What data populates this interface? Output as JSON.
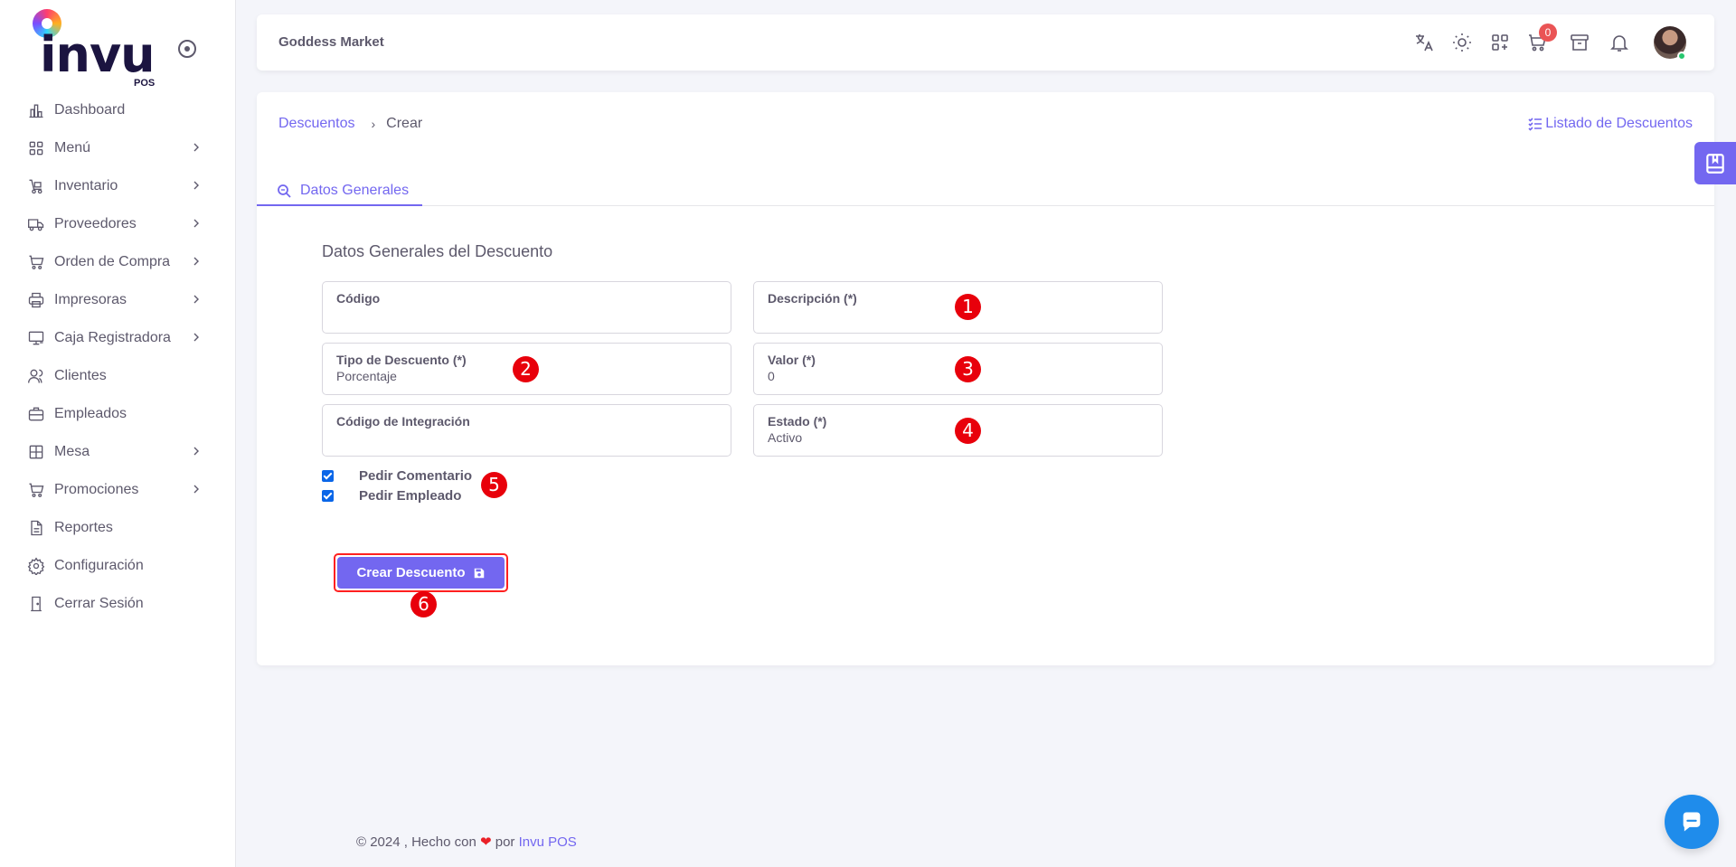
{
  "app": {
    "logo_text": "invu",
    "logo_sub": "POS"
  },
  "sidebar": {
    "items": [
      {
        "label": "Dashboard",
        "icon": "chart-bar-icon",
        "has_children": false
      },
      {
        "label": "Menú",
        "icon": "grid-icon",
        "has_children": true
      },
      {
        "label": "Inventario",
        "icon": "cart-dolly-icon",
        "has_children": true
      },
      {
        "label": "Proveedores",
        "icon": "truck-icon",
        "has_children": true
      },
      {
        "label": "Orden de Compra",
        "icon": "shopping-cart-icon",
        "has_children": true
      },
      {
        "label": "Impresoras",
        "icon": "printer-icon",
        "has_children": true
      },
      {
        "label": "Caja Registradora",
        "icon": "cash-register-icon",
        "has_children": true
      },
      {
        "label": "Clientes",
        "icon": "users-icon",
        "has_children": false
      },
      {
        "label": "Empleados",
        "icon": "briefcase-icon",
        "has_children": false
      },
      {
        "label": "Mesa",
        "icon": "table-icon",
        "has_children": true
      },
      {
        "label": "Promociones",
        "icon": "cart-promo-icon",
        "has_children": true
      },
      {
        "label": "Reportes",
        "icon": "document-icon",
        "has_children": false
      },
      {
        "label": "Configuración",
        "icon": "gear-icon",
        "has_children": false
      },
      {
        "label": "Cerrar Sesión",
        "icon": "door-icon",
        "has_children": false
      }
    ]
  },
  "topbar": {
    "store_name": "Goddess Market",
    "cart_count": "0",
    "icons": [
      "translate-icon",
      "sun-icon",
      "apps-add-icon",
      "cart-icon",
      "archive-icon",
      "bell-icon"
    ]
  },
  "breadcrumb": {
    "parent": "Descuentos",
    "current": "Crear"
  },
  "list_link": "Listado de Descuentos",
  "tabs": [
    {
      "label": "Datos Generales",
      "active": true
    }
  ],
  "form": {
    "title": "Datos Generales del Descuento",
    "fields": {
      "codigo": {
        "label": "Código",
        "value": ""
      },
      "descripcion": {
        "label": "Descripción (*)",
        "value": ""
      },
      "tipo": {
        "label": "Tipo de Descuento (*)",
        "value": "Porcentaje"
      },
      "valor": {
        "label": "Valor (*)",
        "value": "0"
      },
      "integracion": {
        "label": "Código de Integración",
        "value": ""
      },
      "estado": {
        "label": "Estado (*)",
        "value": "Activo"
      }
    },
    "checkboxes": [
      {
        "label": "Pedir Comentario",
        "checked": true
      },
      {
        "label": "Pedir Empleado",
        "checked": true
      }
    ],
    "submit_label": "Crear Descuento"
  },
  "markers": [
    "1",
    "2",
    "3",
    "4",
    "5",
    "6"
  ],
  "footer": {
    "prefix": "© 2024 , Hecho con",
    "heart": "❤",
    "by": "por",
    "brand": "Invu POS"
  },
  "colors": {
    "primary": "#7367f0",
    "marker": "#e8000b",
    "badge": "#ea5455",
    "online": "#28c76f",
    "chat": "#1f8ceb"
  }
}
